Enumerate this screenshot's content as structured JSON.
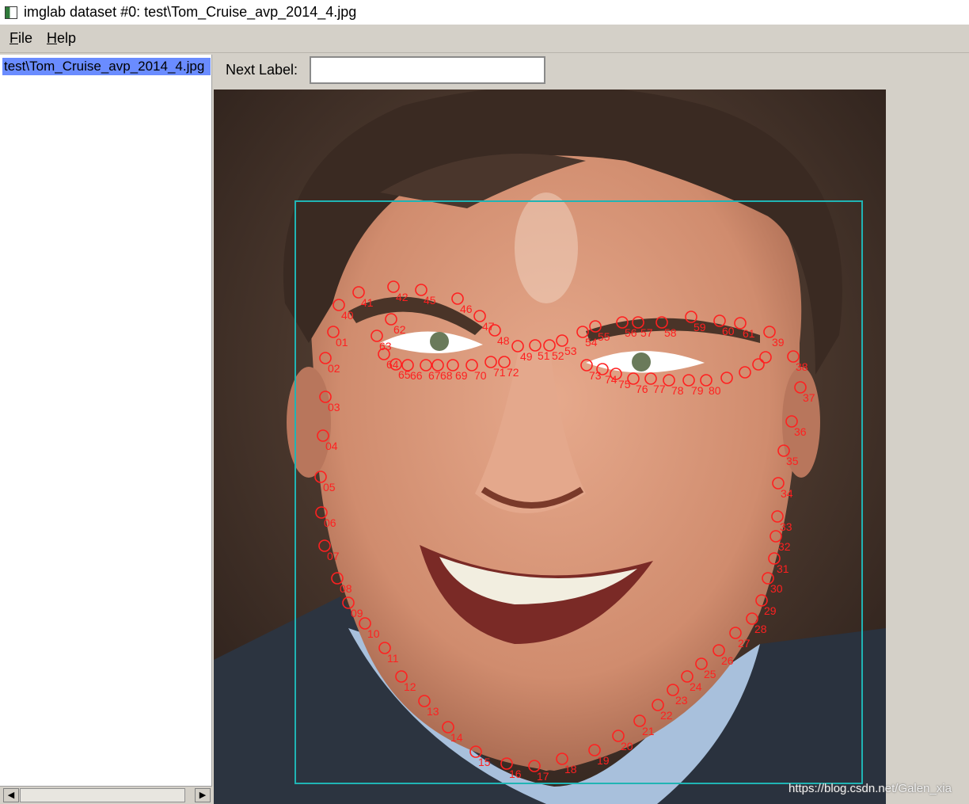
{
  "window": {
    "title": "imglab dataset #0: test\\Tom_Cruise_avp_2014_4.jpg",
    "icon": "app-icon"
  },
  "menu": {
    "items": [
      {
        "mnemonic": "F",
        "rest": "ile"
      },
      {
        "mnemonic": "H",
        "rest": "elp"
      }
    ]
  },
  "file_list": {
    "selected": "test\\Tom_Cruise_avp_2014_4.jpg",
    "selection_color": "#6a8cff"
  },
  "label_bar": {
    "label": "Next Label:",
    "value": ""
  },
  "annotation": {
    "box_color": "#20b4b4",
    "landmark_color": "#ff2020",
    "landmark_labels": [
      "01",
      "02",
      "03",
      "04",
      "05",
      "06",
      "07",
      "08",
      "09",
      "10",
      "11",
      "12",
      "13",
      "14",
      "15",
      "16",
      "17",
      "18",
      "19",
      "20",
      "21",
      "22",
      "23",
      "24",
      "25",
      "26",
      "27",
      "28",
      "29",
      "30",
      "31",
      "32",
      "33",
      "34",
      "35",
      "36",
      "37",
      "38",
      "39",
      "40",
      "41",
      "42",
      "45",
      "46",
      "47",
      "48",
      "49",
      "51",
      "52",
      "53",
      "54",
      "55",
      "56",
      "57",
      "58",
      "59",
      "60",
      "61",
      "62",
      "63",
      "64",
      "65",
      "66",
      "67",
      "68",
      "69",
      "70",
      "71",
      "72",
      "73",
      "74",
      "75",
      "76",
      "77",
      "78",
      "79",
      "80"
    ]
  },
  "watermark": "https://blog.csdn.net/Galen_xia"
}
